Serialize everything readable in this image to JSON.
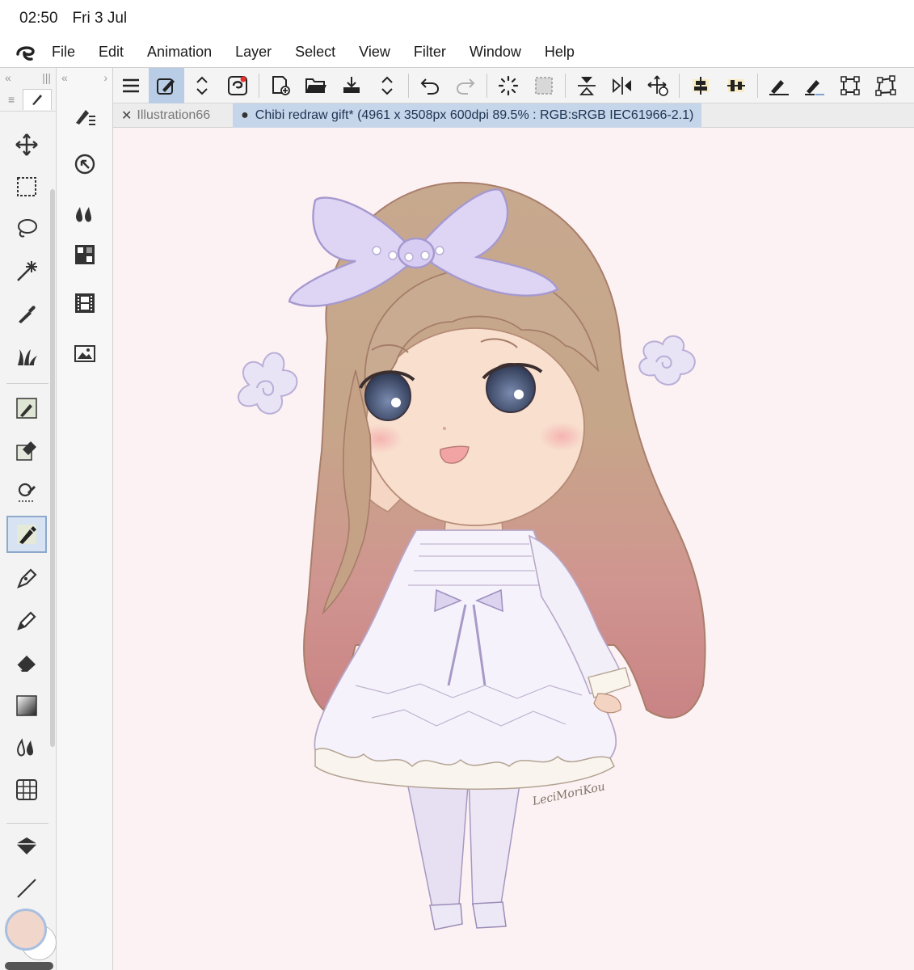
{
  "status": {
    "time": "02:50",
    "date": "Fri 3 Jul"
  },
  "menu": [
    "File",
    "Edit",
    "Animation",
    "Layer",
    "Select",
    "View",
    "Filter",
    "Window",
    "Help"
  ],
  "tabs": [
    {
      "label": "Illustration66",
      "active": false
    },
    {
      "label": "Chibi redraw gift* (4961 x 3508px 600dpi 89.5% : RGB:sRGB IEC61966-2.1)",
      "active": true
    }
  ],
  "colors": {
    "main": "#f1d6cc",
    "sub": "#ffffff",
    "canvas_bg": "#fdf2f3",
    "accent": "#b9cde6"
  },
  "signature": "LeciMoriKou"
}
